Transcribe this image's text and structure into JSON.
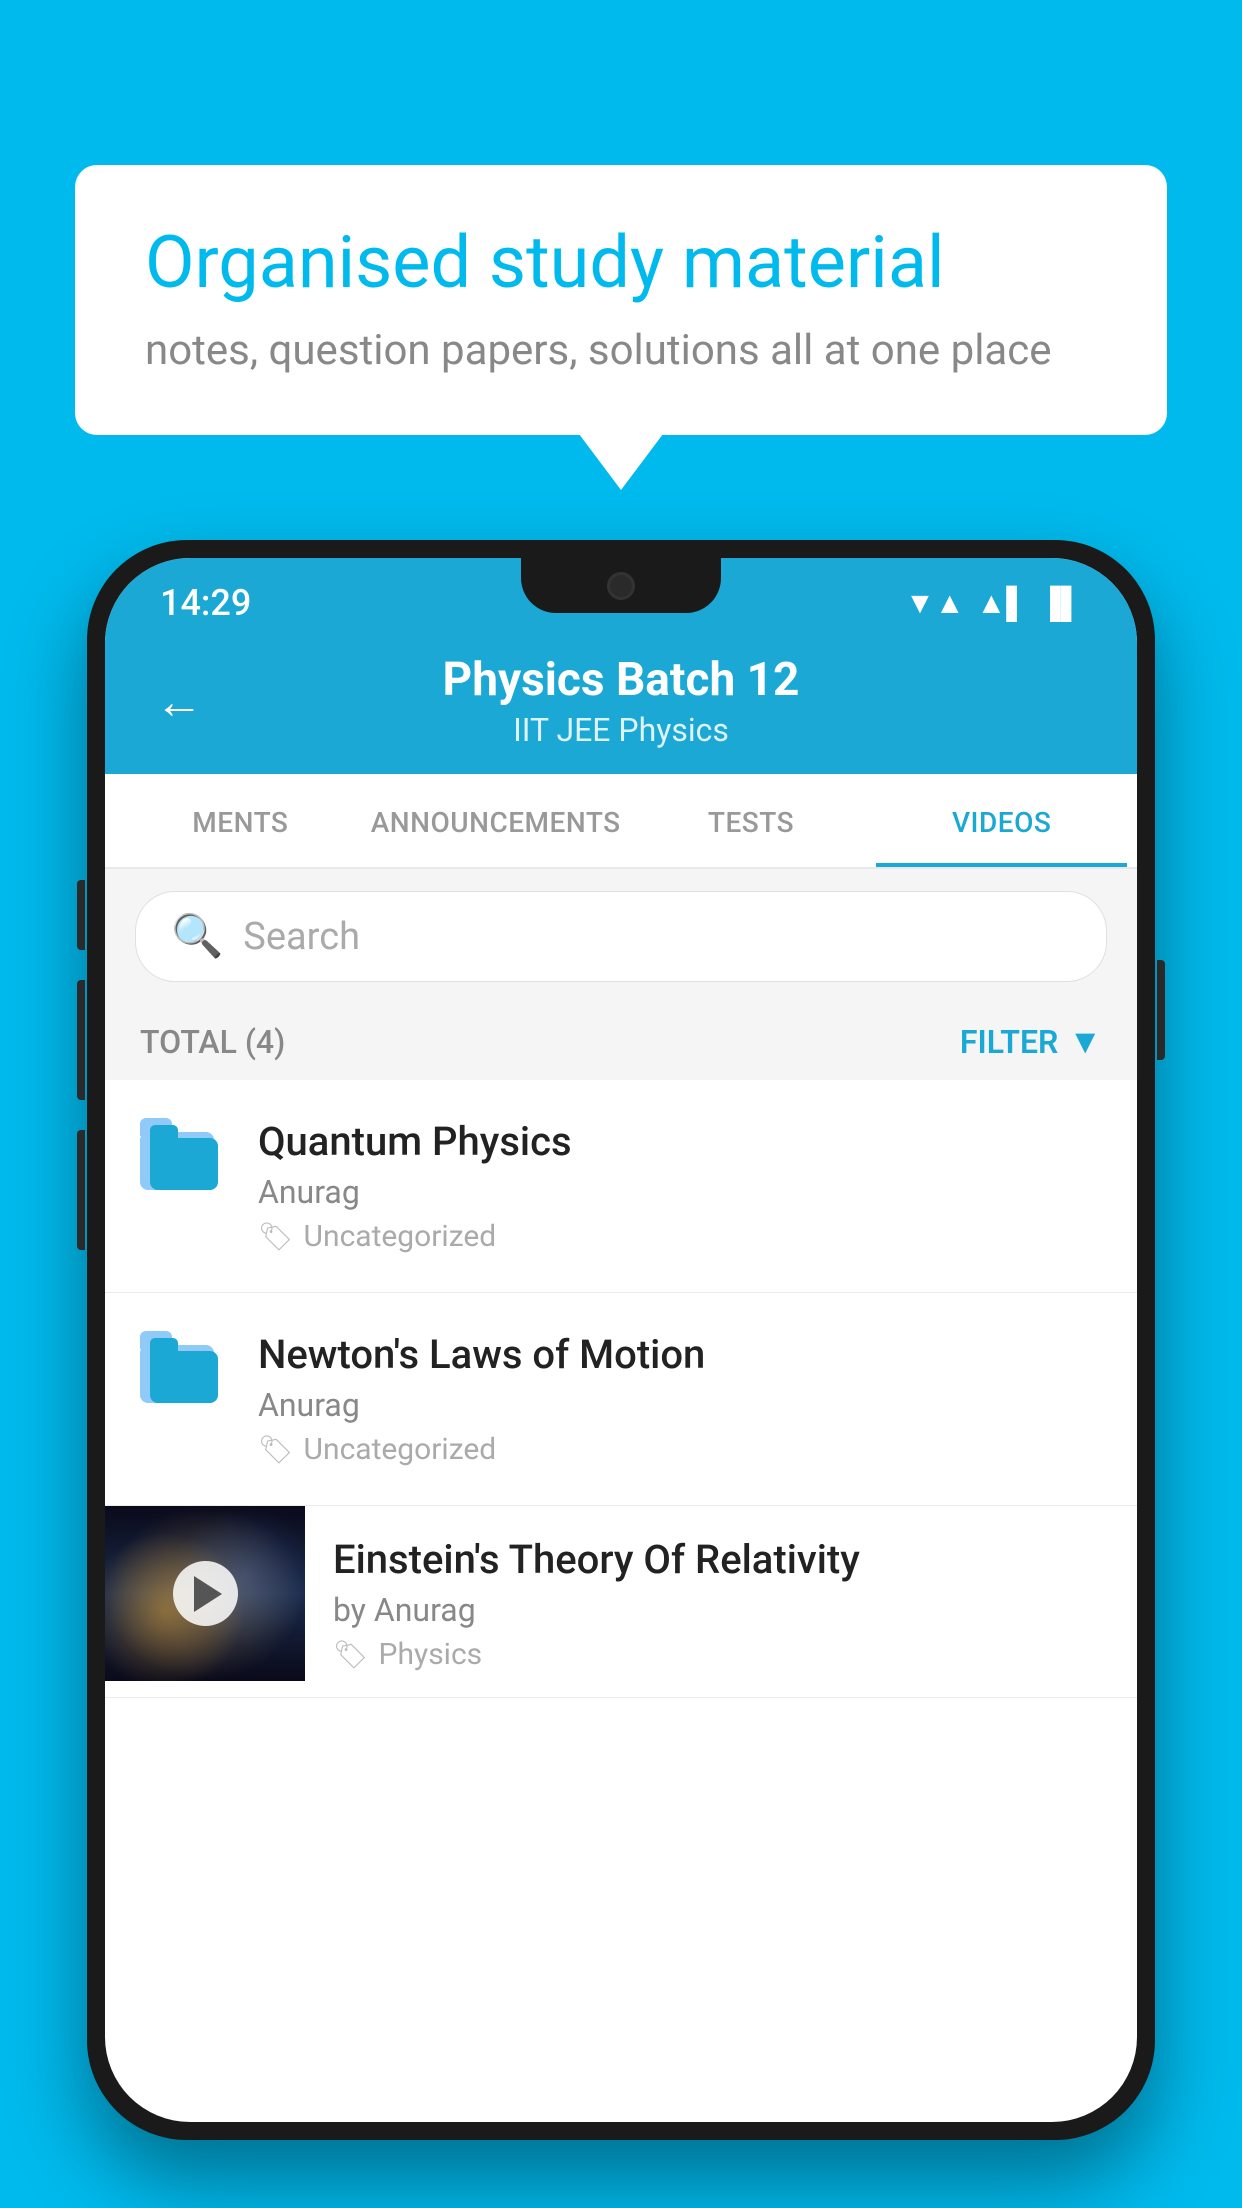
{
  "background": {
    "color": "#00BAED"
  },
  "speech_bubble": {
    "title": "Organised study material",
    "subtitle": "notes, question papers, solutions all at one place"
  },
  "phone": {
    "status_bar": {
      "time": "14:29",
      "icons": [
        "wifi",
        "signal",
        "battery"
      ]
    },
    "header": {
      "title": "Physics Batch 12",
      "subtitle": "IIT JEE   Physics",
      "back_label": "←"
    },
    "tabs": [
      {
        "label": "MENTS",
        "active": false
      },
      {
        "label": "ANNOUNCEMENTS",
        "active": false
      },
      {
        "label": "TESTS",
        "active": false
      },
      {
        "label": "VIDEOS",
        "active": true
      }
    ],
    "search": {
      "placeholder": "Search"
    },
    "filter": {
      "total_label": "TOTAL (4)",
      "filter_label": "FILTER"
    },
    "items": [
      {
        "type": "folder",
        "title": "Quantum Physics",
        "author": "Anurag",
        "tag": "Uncategorized"
      },
      {
        "type": "folder",
        "title": "Newton's Laws of Motion",
        "author": "Anurag",
        "tag": "Uncategorized"
      },
      {
        "type": "video",
        "title": "Einstein's Theory Of Relativity",
        "author": "by Anurag",
        "tag": "Physics"
      }
    ]
  }
}
